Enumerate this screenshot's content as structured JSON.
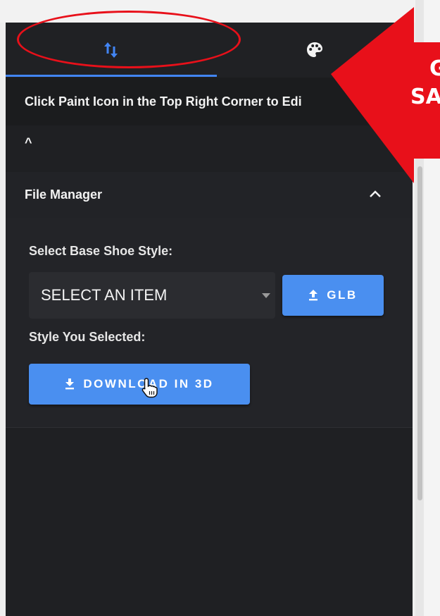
{
  "tabs": [
    {
      "icon": "sort-arrows-icon",
      "active": true
    },
    {
      "icon": "palette-icon",
      "active": false
    }
  ],
  "hint": {
    "text": "Click Paint Icon in the Top Right Corner to Edi"
  },
  "collapse_caret": "^",
  "file_manager": {
    "title": "File Manager",
    "base_style_label": "Select Base Shoe Style:",
    "select_value": "SELECT AN ITEM",
    "glb_button": "GLB",
    "selected_label": "Style You Selected:",
    "download_button": "DOWNLOAD IN 3D"
  },
  "annotation": {
    "arrow_text_line1": "G",
    "arrow_text_line2": "SAV"
  },
  "colors": {
    "accent": "#4285f4",
    "button": "#4a8ff0",
    "panel": "#1f2023",
    "annotation_red": "#e8101a"
  }
}
